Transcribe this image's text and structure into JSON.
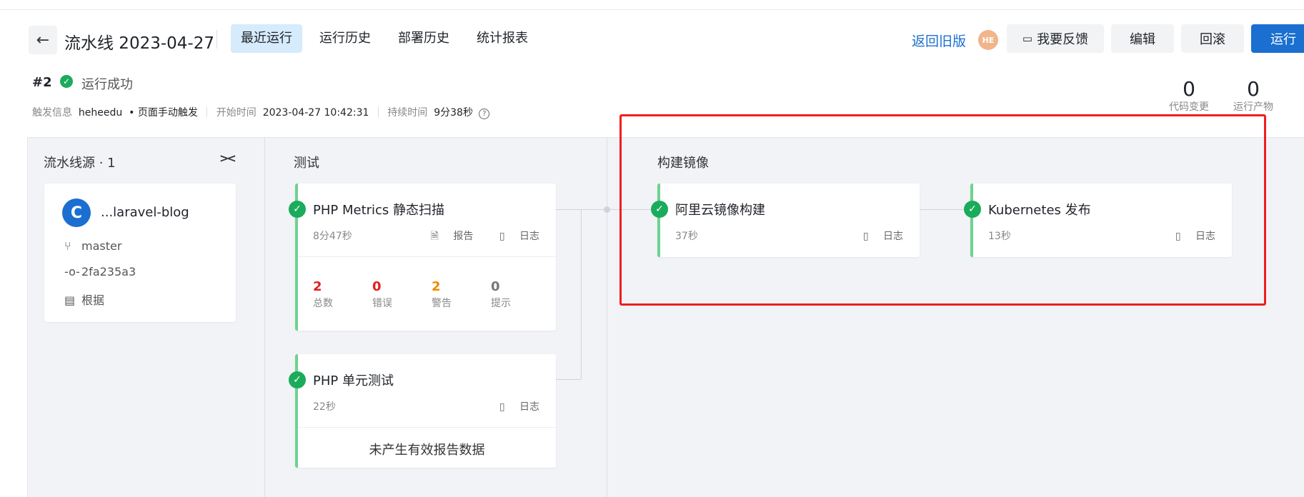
{
  "header": {
    "back_icon": "arrow-left-icon",
    "title": "流水线 2023-04-27",
    "tabs": [
      {
        "label": "最近运行",
        "active": true
      },
      {
        "label": "运行历史",
        "active": false
      },
      {
        "label": "部署历史",
        "active": false
      },
      {
        "label": "统计报表",
        "active": false
      }
    ],
    "back_old_version": "返回旧版",
    "avatar_initials": "HE",
    "feedback_label": "我要反馈",
    "edit_label": "编辑",
    "rollback_label": "回滚",
    "run_label": "运行"
  },
  "run": {
    "number": "#2",
    "status": "运行成功",
    "trigger_key": "触发信息",
    "trigger_user": "heheedu",
    "trigger_method": "• 页面手动触发",
    "start_key": "开始时间",
    "start_time": "2023-04-27 10:42:31",
    "duration_key": "持续时间",
    "duration": "9分38秒"
  },
  "stats": [
    {
      "value": "0",
      "label": "代码变更"
    },
    {
      "value": "0",
      "label": "运行产物"
    }
  ],
  "source": {
    "stage_title": "流水线源 · 1",
    "repo_name": "...laravel-blog",
    "branch": "master",
    "commit": "2fa235a3",
    "basis": "根据"
  },
  "stages": {
    "test": {
      "title": "测试",
      "jobs": [
        {
          "name": "PHP Metrics 静态扫描",
          "duration": "8分47秒",
          "report_label": "报告",
          "log_label": "日志",
          "metrics": [
            {
              "value": "2",
              "label": "总数",
              "color": "#e02020"
            },
            {
              "value": "0",
              "label": "错误",
              "color": "#e02020"
            },
            {
              "value": "2",
              "label": "警告",
              "color": "#f08a00"
            },
            {
              "value": "0",
              "label": "提示",
              "color": "#777777"
            }
          ]
        },
        {
          "name": "PHP 单元测试",
          "duration": "22秒",
          "log_label": "日志",
          "no_report": "未产生有效报告数据"
        }
      ]
    },
    "build": {
      "title": "构建镜像",
      "jobs": [
        {
          "name": "阿里云镜像构建",
          "duration": "37秒",
          "log_label": "日志"
        },
        {
          "name": "Kubernetes 发布",
          "duration": "13秒",
          "log_label": "日志"
        }
      ]
    }
  },
  "colors": {
    "accent": "#1a6fd0",
    "success": "#1aab5b",
    "highlight": "#f01e1e"
  }
}
